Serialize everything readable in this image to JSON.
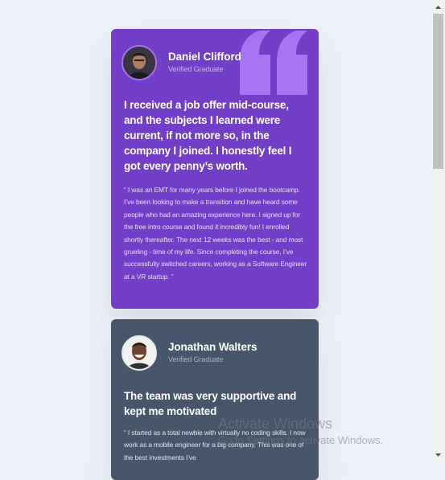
{
  "testimonials": [
    {
      "name": "Daniel Clifford",
      "status": "Verified Graduate",
      "headline": "I received a job offer mid-course, and the subjects I learned were current, if not more so, in the company I joined. I honestly feel I got every penny’s worth.",
      "body": "“ I was an EMT for many years before I joined the bootcamp. I’ve been looking to make a transition and have heard some people who had an amazing experience here. I signed up for the free intro course and found it incredibly fun! I enrolled shortly thereafter. The next 12 weeks was the best - and most grueling - time of my life. Since completing the course, I’ve successfully switched careers, working as a Software Engineer at a VR startup. ”",
      "background": "#733fc8",
      "icon": "quotation-icon"
    },
    {
      "name": "Jonathan Walters",
      "status": "Verified Graduate",
      "headline": "The team was very supportive and kept me motivated",
      "body": "“ I started as a total newbie with virtually no coding skills. I now work as a mobile engineer for a big company. This was one of the best investments I’ve",
      "background": "#48556a"
    }
  ],
  "watermark": {
    "title": "Activate Windows",
    "subtitle": "Go to Settings to activate Windows."
  },
  "colors": {
    "page_background": "#edf1f8",
    "accent_purple": "#733fc8",
    "quote_icon": "#a775f1",
    "card_slate": "#48556a"
  }
}
